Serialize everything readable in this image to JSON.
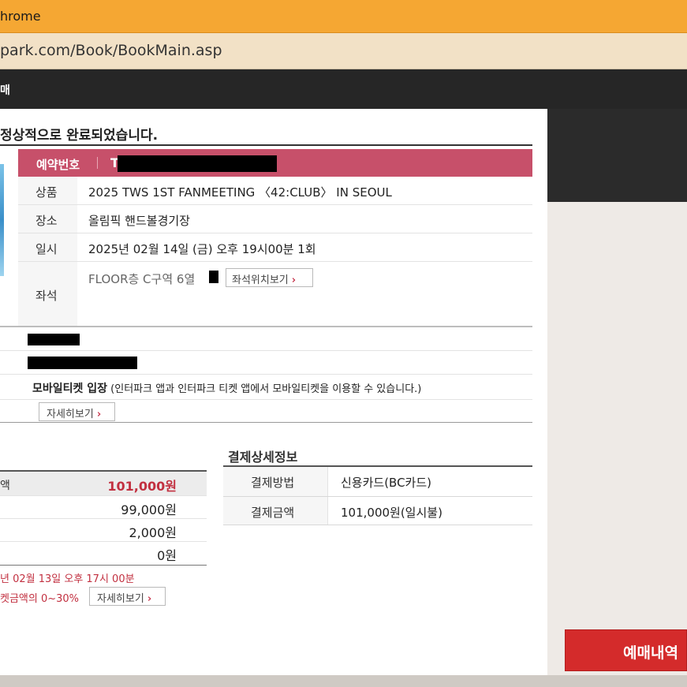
{
  "browser": {
    "title": "hrome",
    "url": "park.com/Book/BookMain.asp"
  },
  "header": {
    "title": "매"
  },
  "heading": "정상적으로 완료되었습니다.",
  "reservation": {
    "label": "예약번호",
    "value_prefix": "T"
  },
  "details": [
    {
      "label": "상품",
      "value": "2025 TWS 1ST FANMEETING 〈42:CLUB〉 IN SEOUL"
    },
    {
      "label": "장소",
      "value": "올림픽 핸드볼경기장"
    },
    {
      "label": "일시",
      "value": "2025년 02월 14일 (금) 오후 19시00분 1회"
    },
    {
      "label": "좌석",
      "value": "FLOOR층 C구역 6열"
    }
  ],
  "seat_button": "좌석위치보기",
  "mobile": {
    "title": "모바일티켓 입장",
    "desc": " (인터파크 앱과 인터파크 티켓 앱에서 모바일티켓을 이용할 수 있습니다.)"
  },
  "detail_button": "자세히보기",
  "amounts": [
    {
      "label": "액",
      "value": "101,000원"
    },
    {
      "label": "",
      "value": "99,000원"
    },
    {
      "label": "",
      "value": "2,000원"
    },
    {
      "label": "",
      "value": "0원"
    }
  ],
  "cancel": {
    "deadline": "년 02월 13일 오후 17시 00분",
    "fee": "켓금액의 0~30%",
    "button": "자세히보기"
  },
  "payment": {
    "title": "결제상세정보",
    "rows": [
      {
        "label": "결제방법",
        "value": "신용카드(BC카드)"
      },
      {
        "label": "결제금액",
        "value": "101,000원(일시불)"
      }
    ]
  },
  "action_button": "예매내역"
}
